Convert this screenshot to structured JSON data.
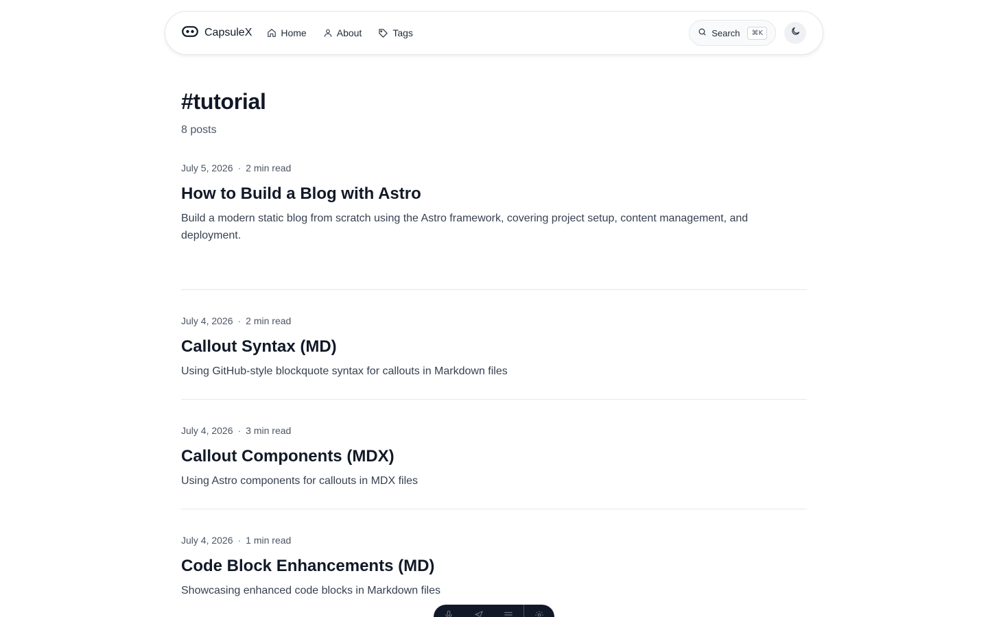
{
  "nav": {
    "brand": "CapsuleX",
    "links": [
      {
        "label": "Home",
        "icon": "home-icon"
      },
      {
        "label": "About",
        "icon": "user-icon"
      },
      {
        "label": "Tags",
        "icon": "tag-icon"
      }
    ],
    "search_label": "Search",
    "search_shortcut": "⌘K",
    "theme_toggle_icon": "moon-icon"
  },
  "page": {
    "title": "#tutorial",
    "count": "8 posts"
  },
  "posts": [
    {
      "date": "July 5, 2026",
      "read_time": "2 min read",
      "title": "How to Build a Blog with Astro",
      "description": "Build a modern static blog from scratch using the Astro framework, covering project setup, content management, and deployment."
    },
    {
      "date": "July 4, 2026",
      "read_time": "2 min read",
      "title": "Callout Syntax (MD)",
      "description": "Using GitHub-style blockquote syntax for callouts in Markdown files"
    },
    {
      "date": "July 4, 2026",
      "read_time": "3 min read",
      "title": "Callout Components (MDX)",
      "description": "Using Astro components for callouts in MDX files"
    },
    {
      "date": "July 4, 2026",
      "read_time": "1 min read",
      "title": "Code Block Enhancements (MD)",
      "description": "Showcasing enhanced code blocks in Markdown files"
    }
  ],
  "floating_toolbar": {
    "icons": [
      "mic-icon",
      "send-icon",
      "menu-icon",
      "settings-icon"
    ]
  },
  "colors": {
    "text": "#111827",
    "muted": "#4b5563",
    "border": "#e5e7eb",
    "toolbar_bg": "#111827"
  }
}
